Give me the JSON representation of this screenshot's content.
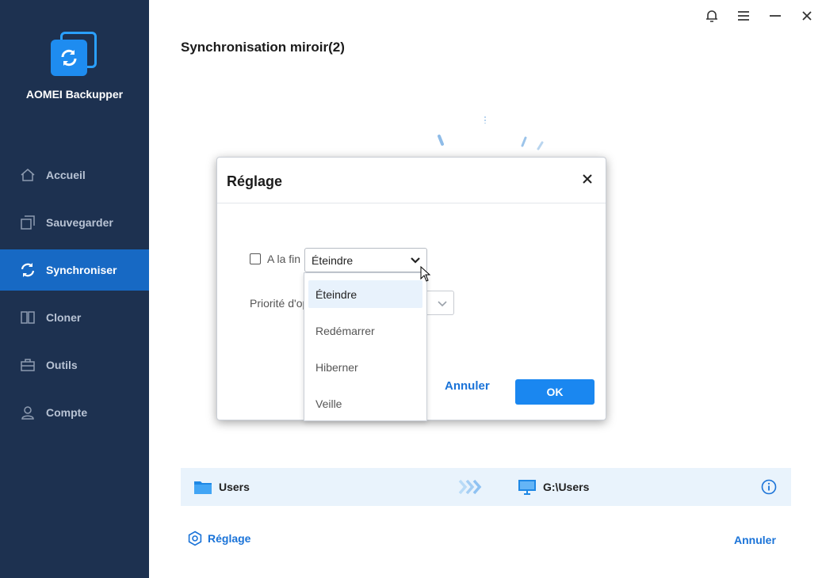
{
  "app": {
    "name": "AOMEI Backupper"
  },
  "sidebar": {
    "items": [
      {
        "label": "Accueil",
        "icon": "home-icon"
      },
      {
        "label": "Sauvegarder",
        "icon": "backup-icon"
      },
      {
        "label": "Synchroniser",
        "icon": "sync-icon",
        "active": true
      },
      {
        "label": "Cloner",
        "icon": "clone-icon"
      },
      {
        "label": "Outils",
        "icon": "toolbox-icon"
      },
      {
        "label": "Compte",
        "icon": "user-icon"
      }
    ]
  },
  "titlebar": {
    "icons": [
      "bell-icon",
      "menu-icon",
      "minimize-icon",
      "close-icon"
    ]
  },
  "page": {
    "title": "Synchronisation miroir(2)"
  },
  "sync": {
    "source": "Users",
    "destination": "G:\\Users"
  },
  "footer": {
    "settings_label": "Réglage",
    "cancel_label": "Annuler"
  },
  "dialog": {
    "title": "Réglage",
    "checkbox_label": "A la fin",
    "checkbox_checked": false,
    "select_value": "Éteindre",
    "priority_label": "Priorité d'op",
    "cancel_label": "Annuler",
    "ok_label": "OK"
  },
  "dropdown": {
    "options": [
      "Éteindre",
      "Redémarrer",
      "Hiberner",
      "Veille"
    ],
    "selected": "Éteindre"
  },
  "colors": {
    "sidebar_bg": "#1d3150",
    "active_bg": "#1769c4",
    "accent": "#1a87f0",
    "link": "#1a73d8"
  }
}
